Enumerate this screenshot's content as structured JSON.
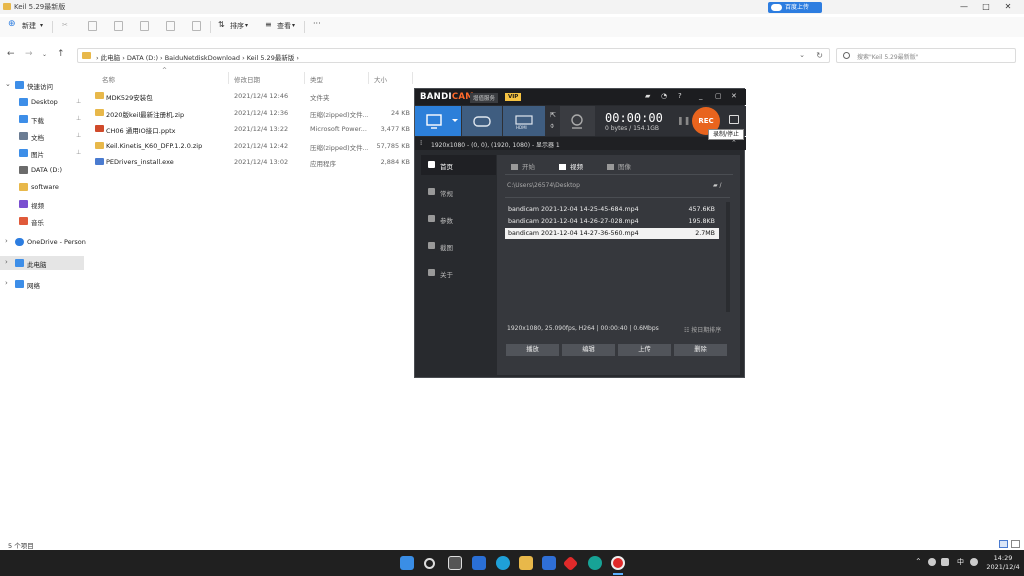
{
  "window": {
    "title": "Keil 5.29最新版",
    "upload_label": "百度上传",
    "controls": [
      "—",
      "□",
      "✕"
    ]
  },
  "toolbar": {
    "new_label": "新建",
    "sort_label": "排序",
    "view_label": "查看",
    "more_label": "···"
  },
  "address": {
    "crumbs": "›  此电脑  ›  DATA (D:)  ›  BaiduNetdiskDownload  ›  Keil 5.29最新版  ›",
    "search_placeholder": "搜索\"Keil 5.29最新版\""
  },
  "sidebar": {
    "quick_access": "快速访问",
    "items": [
      {
        "label": "Desktop",
        "color": "#3d8ee8",
        "pinned": true
      },
      {
        "label": "下载",
        "color": "#3d8ee8",
        "pinned": true
      },
      {
        "label": "文档",
        "color": "#6b7c93",
        "pinned": true
      },
      {
        "label": "图片",
        "color": "#3d8ee8",
        "pinned": true
      },
      {
        "label": "DATA (D:)",
        "color": "#6b6b6b",
        "pinned": false
      },
      {
        "label": "software",
        "color": "#e8b84a",
        "pinned": false
      },
      {
        "label": "视频",
        "color": "#7a4fd0",
        "pinned": false
      },
      {
        "label": "音乐",
        "color": "#e05a3a",
        "pinned": false
      }
    ],
    "onedrive": "OneDrive - Person",
    "this_pc": "此电脑",
    "network": "网络"
  },
  "filelist": {
    "headers": {
      "name": "名称",
      "date": "修改日期",
      "type": "类型",
      "size": "大小"
    },
    "rows": [
      {
        "name": "MDK529安装包",
        "date": "2021/12/4 12:46",
        "type": "文件夹",
        "size": "",
        "color": "#e8b84a"
      },
      {
        "name": "2020版keil最新注册机.zip",
        "date": "2021/12/4 12:36",
        "type": "压缩(zipped)文件...",
        "size": "24 KB",
        "color": "#e8b84a"
      },
      {
        "name": "CH06 通用IO接口.pptx",
        "date": "2021/12/4 13:22",
        "type": "Microsoft Power...",
        "size": "3,477 KB",
        "color": "#d04a2a"
      },
      {
        "name": "Keil.Kinetis_K60_DFP.1.2.0.zip",
        "date": "2021/12/4 12:42",
        "type": "压缩(zipped)文件...",
        "size": "57,785 KB",
        "color": "#e8b84a"
      },
      {
        "name": "PEDrivers_install.exe",
        "date": "2021/12/4 13:02",
        "type": "应用程序",
        "size": "2,884 KB",
        "color": "#4a7bd0"
      }
    ]
  },
  "status": {
    "count": "5 个项目"
  },
  "bandicam": {
    "logo_a": "BANDI",
    "logo_b": "CAM",
    "buy_label": "增值服务",
    "vip_label": "VIP",
    "hdmi_label": "HDMI",
    "timer": "00:00:00",
    "bytes": "0 bytes / 154.1GB",
    "rec_label": "REC",
    "tooltip": "录制/停止",
    "info": "1920x1080 - (0, 0), (1920, 1080) - 显示器 1",
    "nav": [
      "首页",
      "常规",
      "参数",
      "截图",
      "关于"
    ],
    "tabs": [
      "开始",
      "视频",
      "图像"
    ],
    "path": "C:\\Users\\26574\\Desktop",
    "files": [
      {
        "name": "bandicam 2021-12-04 14-25-45-684.mp4",
        "size": "457.6KB"
      },
      {
        "name": "bandicam 2021-12-04 14-26-27-028.mp4",
        "size": "195.8KB"
      },
      {
        "name": "bandicam 2021-12-04 14-27-36-560.mp4",
        "size": "2.7MB"
      }
    ],
    "meta": "1920x1080, 25.090fps, H264 | 00:00:40 | 0.6Mbps",
    "convert": "☷ 按日期排序",
    "buttons": [
      "播放",
      "编辑",
      "上传",
      "删除"
    ]
  },
  "taskbar": {
    "lang": "中",
    "time": "14:29",
    "date": "2021/12/4"
  }
}
